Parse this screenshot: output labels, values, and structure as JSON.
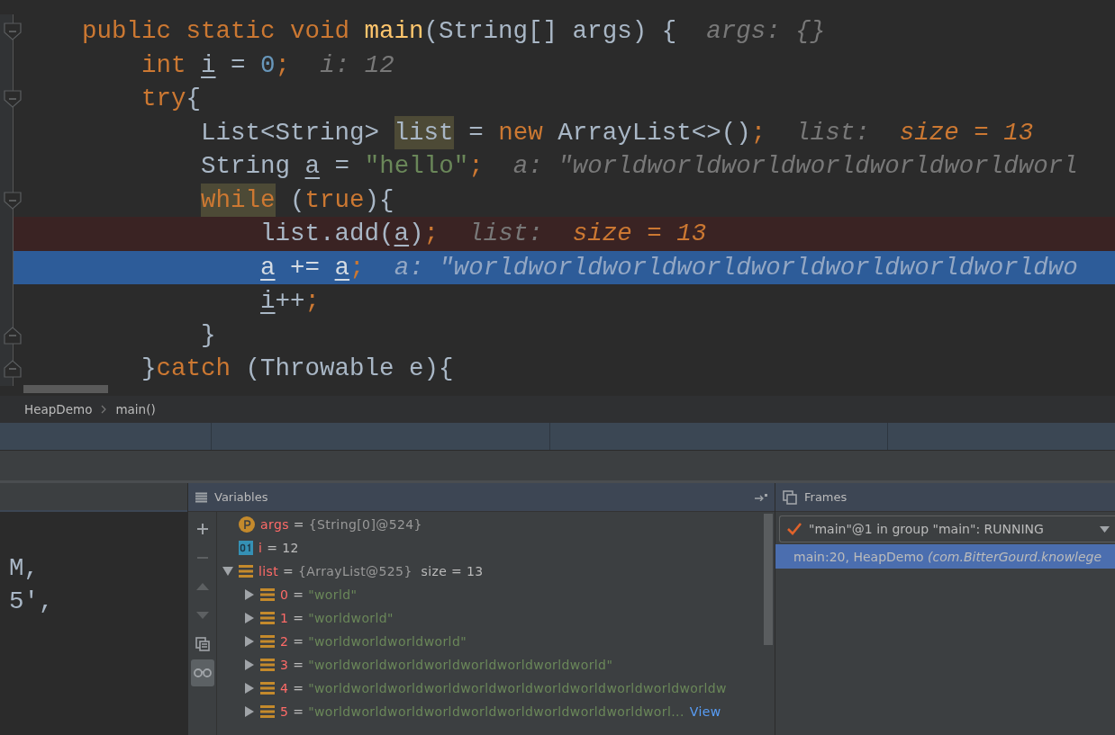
{
  "editor": {
    "lines": [
      {
        "kind": "normal",
        "fold_start": true,
        "tokens": [
          {
            "text": "    public static void ",
            "kind": "kw"
          },
          {
            "text": "main",
            "kind": "fn"
          },
          {
            "text": "(String[] args) {",
            "kind": "plain"
          },
          {
            "text": "  args: {}",
            "kind": "hint"
          }
        ]
      },
      {
        "kind": "normal",
        "tokens": [
          {
            "text": "        int ",
            "kind": "kw"
          },
          {
            "text": "i",
            "kind": "var"
          },
          {
            "text": " = ",
            "kind": "plain"
          },
          {
            "text": "0",
            "kind": "num"
          },
          {
            "text": ";",
            "kind": "kw"
          },
          {
            "text": "  i: 12",
            "kind": "hint"
          }
        ]
      },
      {
        "kind": "normal",
        "fold_start": true,
        "tokens": [
          {
            "text": "        try",
            "kind": "kw"
          },
          {
            "text": "{",
            "kind": "plain"
          }
        ]
      },
      {
        "kind": "normal",
        "tokens": [
          {
            "text": "            List<String> ",
            "kind": "plain"
          },
          {
            "text": "list",
            "kind": "usage"
          },
          {
            "text": " = ",
            "kind": "plain"
          },
          {
            "text": "new",
            "kind": "kw"
          },
          {
            "text": " ArrayList<>()",
            "kind": "plain"
          },
          {
            "text": ";",
            "kind": "kw"
          },
          {
            "text": "  list:  ",
            "kind": "hint"
          },
          {
            "text": "size = 13",
            "kind": "hintval"
          }
        ]
      },
      {
        "kind": "normal",
        "tokens": [
          {
            "text": "            String ",
            "kind": "plain"
          },
          {
            "text": "a",
            "kind": "var"
          },
          {
            "text": " = ",
            "kind": "plain"
          },
          {
            "text": "\"hello\"",
            "kind": "str"
          },
          {
            "text": ";",
            "kind": "kw"
          },
          {
            "text": "  a: \"worldworldworldworldworldworldworl",
            "kind": "hint"
          }
        ]
      },
      {
        "kind": "normal",
        "fold_start": true,
        "tokens": [
          {
            "text": "            while",
            "kind": "kwusage"
          },
          {
            "text": " (",
            "kind": "plain"
          },
          {
            "text": "true",
            "kind": "kw"
          },
          {
            "text": "){",
            "kind": "plain"
          }
        ]
      },
      {
        "kind": "breakpoint",
        "tokens": [
          {
            "text": "                list.add(",
            "kind": "plain"
          },
          {
            "text": "a",
            "kind": "var"
          },
          {
            "text": ")",
            "kind": "plain"
          },
          {
            "text": ";",
            "kind": "kw"
          },
          {
            "text": "  list:  ",
            "kind": "hint"
          },
          {
            "text": "size = 13",
            "kind": "hintval"
          }
        ]
      },
      {
        "kind": "execution",
        "tokens": [
          {
            "text": "                a",
            "kind": "var"
          },
          {
            "text": " += ",
            "kind": "plain"
          },
          {
            "text": "a",
            "kind": "var"
          },
          {
            "text": ";",
            "kind": "kw"
          },
          {
            "text": "  a: \"worldworldworldworldworldworldworldworldwo",
            "kind": "hint"
          }
        ]
      },
      {
        "kind": "normal",
        "tokens": [
          {
            "text": "                i",
            "kind": "var"
          },
          {
            "text": "++",
            "kind": "plain"
          },
          {
            "text": ";",
            "kind": "kw"
          }
        ]
      },
      {
        "kind": "normal",
        "fold_end": true,
        "tokens": [
          {
            "text": "            }",
            "kind": "plain"
          }
        ]
      },
      {
        "kind": "normal",
        "fold_end": true,
        "tokens": [
          {
            "text": "        }",
            "kind": "plain"
          },
          {
            "text": "catch",
            "kind": "kw"
          },
          {
            "text": " (Throwable e){",
            "kind": "plain"
          }
        ]
      }
    ]
  },
  "breadcrumb": [
    "HeapDemo",
    "main()"
  ],
  "console": {
    "lines": [
      "M,",
      "5',"
    ]
  },
  "variables": {
    "title": "Variables",
    "toolbar": [
      {
        "kind": "add",
        "disabled": false,
        "on": false
      },
      {
        "kind": "remove",
        "disabled": true,
        "on": false
      },
      {
        "kind": "up",
        "disabled": true,
        "on": false
      },
      {
        "kind": "down",
        "disabled": true,
        "on": false
      },
      {
        "kind": "copy",
        "disabled": false,
        "on": false
      },
      {
        "kind": "watches",
        "disabled": false,
        "on": true
      }
    ],
    "items": [
      {
        "kind": "param",
        "name": "args",
        "sep": "=",
        "value": {
          "kind": "object",
          "text": "{String[0]@524}"
        }
      },
      {
        "kind": "primitive",
        "name": "i",
        "sep": "=",
        "value": {
          "kind": "primitive",
          "text": "12"
        }
      },
      {
        "kind": "list",
        "name": "list",
        "sep": "=",
        "value": {
          "kind": "object",
          "text": "{ArrayList@525}"
        },
        "extra": "size = 13",
        "expanded": true,
        "children": [
          {
            "kind": "list",
            "name": "0",
            "sep": "=",
            "value": {
              "kind": "string",
              "text": "\"world\""
            },
            "expanded": false
          },
          {
            "kind": "list",
            "name": "1",
            "sep": "=",
            "value": {
              "kind": "string",
              "text": "\"worldworld\""
            },
            "expanded": false
          },
          {
            "kind": "list",
            "name": "2",
            "sep": "=",
            "value": {
              "kind": "string",
              "text": "\"worldworldworldworld\""
            },
            "expanded": false
          },
          {
            "kind": "list",
            "name": "3",
            "sep": "=",
            "value": {
              "kind": "string",
              "text": "\"worldworldworldworldworldworldworldworld\""
            },
            "expanded": false
          },
          {
            "kind": "list",
            "name": "4",
            "sep": "=",
            "value": {
              "kind": "string",
              "text": "\"worldworldworldworldworldworldworldworldworldworldworldw"
            },
            "expanded": false
          },
          {
            "kind": "list",
            "name": "5",
            "sep": "=",
            "value": {
              "kind": "string",
              "text": "\"worldworldworldworldworldworldworldworldworldworl..."
            },
            "expanded": false,
            "link": "View"
          }
        ]
      }
    ]
  },
  "frames": {
    "title": "Frames",
    "thread": "\"main\"@1 in group \"main\": RUNNING",
    "rows": [
      {
        "text": "main:20, HeapDemo *(com.BitterGourd.knowlege*",
        "selected": true
      }
    ]
  }
}
